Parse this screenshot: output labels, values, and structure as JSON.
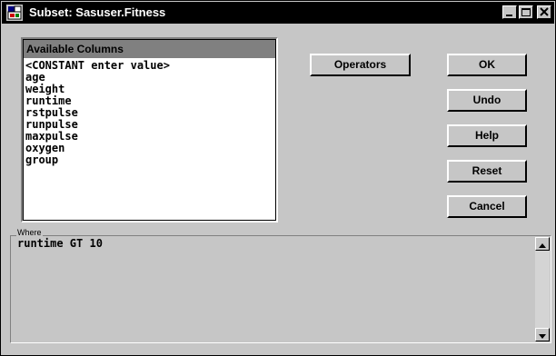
{
  "window": {
    "title": "Subset: Sasuser.Fitness"
  },
  "titlebar": {
    "minimize_icon": "minimize-icon",
    "maximize_icon": "maximize-icon",
    "close_icon": "close-icon"
  },
  "columns": {
    "header": "Available Columns",
    "items": [
      "<CONSTANT enter value>",
      "age",
      "weight",
      "runtime",
      "rstpulse",
      "runpulse",
      "maxpulse",
      "oxygen",
      "group"
    ]
  },
  "buttons": {
    "operators": "Operators",
    "ok": "OK",
    "undo": "Undo",
    "help": "Help",
    "reset": "Reset",
    "cancel": "Cancel"
  },
  "where": {
    "label": "Where",
    "value": "runtime GT 10"
  }
}
